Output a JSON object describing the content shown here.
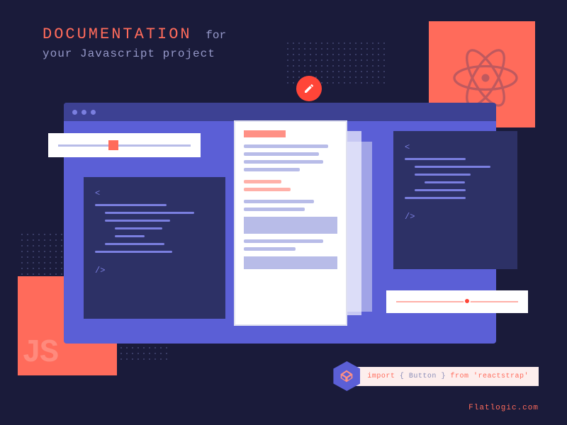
{
  "heading": {
    "main": "DOCUMENTATION",
    "for": "for",
    "sub": "your Javascript project"
  },
  "decorations": {
    "js_label": "JS"
  },
  "code_snippet": {
    "import_kw": "import",
    "brace_open": " { ",
    "component": "Button",
    "brace_close": " } ",
    "from_kw": "from",
    "package": "'reactstrap'"
  },
  "brand": "Flatlogic.com"
}
